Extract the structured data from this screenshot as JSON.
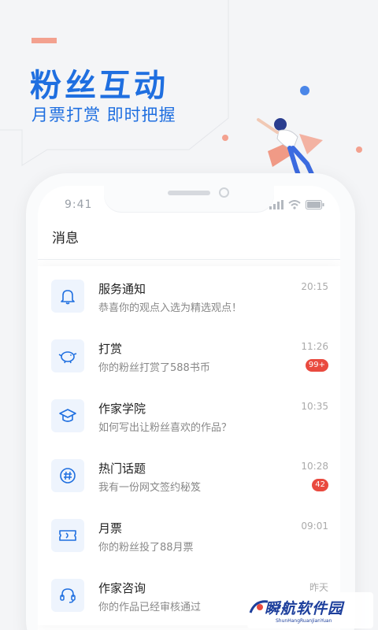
{
  "promo": {
    "headline": "粉丝互动",
    "subhead": "月票打赏 即时把握"
  },
  "status_bar": {
    "time": "9:41"
  },
  "nav": {
    "title": "消息"
  },
  "messages": [
    {
      "icon": "bell-icon",
      "title": "服务通知",
      "subtitle": "恭喜你的观点入选为精选观点！",
      "time": "20:15",
      "badge": ""
    },
    {
      "icon": "piggy-bank-icon",
      "title": "打赏",
      "subtitle": "你的粉丝打赏了588书币",
      "time": "11:26",
      "badge": "99+"
    },
    {
      "icon": "graduation-cap-icon",
      "title": "作家学院",
      "subtitle": "如何写出让粉丝喜欢的作品？",
      "time": "10:35",
      "badge": ""
    },
    {
      "icon": "hashtag-icon",
      "title": "热门话题",
      "subtitle": "我有一份网文签约秘笈",
      "time": "10:28",
      "badge": "42"
    },
    {
      "icon": "ticket-icon",
      "title": "月票",
      "subtitle": "你的粉丝投了88月票",
      "time": "09:01",
      "badge": ""
    },
    {
      "icon": "headset-icon",
      "title": "作家咨询",
      "subtitle": "你的作品已经审核通过",
      "time": "昨天",
      "badge": ""
    }
  ],
  "watermark": {
    "name": "瞬航软件园",
    "url_text": "ShunHangRuanJianYuan"
  },
  "colors": {
    "brand_blue": "#1f6fe0",
    "accent_salmon": "#f3a18f",
    "badge_red": "#e94a3f"
  }
}
